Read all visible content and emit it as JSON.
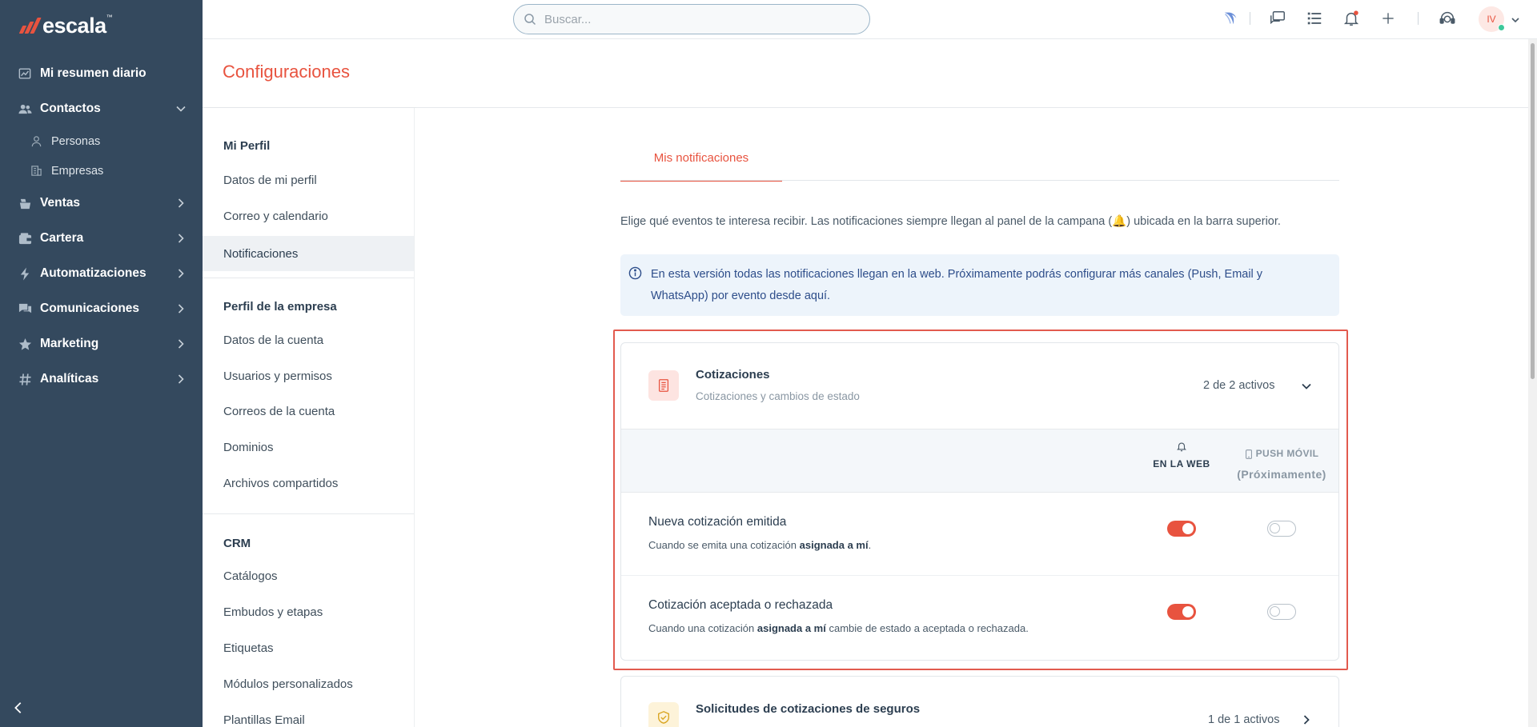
{
  "brand": {
    "name": "escala",
    "mark": "™"
  },
  "sidebar": {
    "items": [
      {
        "label": "Mi resumen diario"
      },
      {
        "label": "Contactos"
      },
      {
        "label": "Personas"
      },
      {
        "label": "Empresas"
      },
      {
        "label": "Ventas"
      },
      {
        "label": "Cartera"
      },
      {
        "label": "Automatizaciones"
      },
      {
        "label": "Comunicaciones"
      },
      {
        "label": "Marketing"
      },
      {
        "label": "Analíticas"
      }
    ]
  },
  "topbar": {
    "search_placeholder": "Buscar...",
    "avatar_initials": "IV"
  },
  "page": {
    "title": "Configuraciones"
  },
  "subnav": {
    "sections": [
      {
        "heading": "Mi Perfil",
        "items": [
          "Datos de mi perfil",
          "Correo y calendario",
          "Notificaciones"
        ]
      },
      {
        "heading": "Perfil de la empresa",
        "items": [
          "Datos de la cuenta",
          "Usuarios y permisos",
          "Correos de la cuenta",
          "Dominios",
          "Archivos compartidos"
        ]
      },
      {
        "heading": "CRM",
        "items": [
          "Catálogos",
          "Embudos y etapas",
          "Etiquetas",
          "Módulos personalizados",
          "Plantillas Email"
        ]
      }
    ],
    "active": "Notificaciones"
  },
  "main": {
    "tab": "Mis notificaciones",
    "intro_before": "Elige qué eventos te interesa recibir. Las notificaciones siempre llegan al panel de la campana (",
    "intro_after": ") ubicada en la barra superior.",
    "info_line1": "En esta versión todas las notificaciones llegan en la web. Próximamente podrás configurar más canales (Push, Email y",
    "info_line2": "WhatsApp) por evento desde aquí.",
    "cards": [
      {
        "title": "Cotizaciones",
        "subtitle": "Cotizaciones y cambios de estado",
        "count": "2 de 2 activos",
        "col_web": "EN LA WEB",
        "col_push": "PUSH MÓVIL",
        "col_push_note": "(Próximamente)",
        "rows": [
          {
            "title": "Nueva cotización emitida",
            "desc_before": "Cuando se emita una cotización ",
            "desc_bold": "asignada a mí",
            "desc_after": ".",
            "web_enabled": true,
            "push_enabled": false
          },
          {
            "title": "Cotización aceptada o rechazada",
            "desc_before": "Cuando una cotización ",
            "desc_bold": "asignada a mí",
            "desc_after": " cambie de estado a aceptada o rechazada.",
            "web_enabled": true,
            "push_enabled": false
          }
        ]
      },
      {
        "title": "Solicitudes de cotizaciones de seguros",
        "count": "1 de 1 activos"
      }
    ]
  },
  "colors": {
    "accent": "#e8533f",
    "sidebar_bg": "#34495e",
    "info_bg": "#edf4fb",
    "highlight": "#e25a4e"
  }
}
